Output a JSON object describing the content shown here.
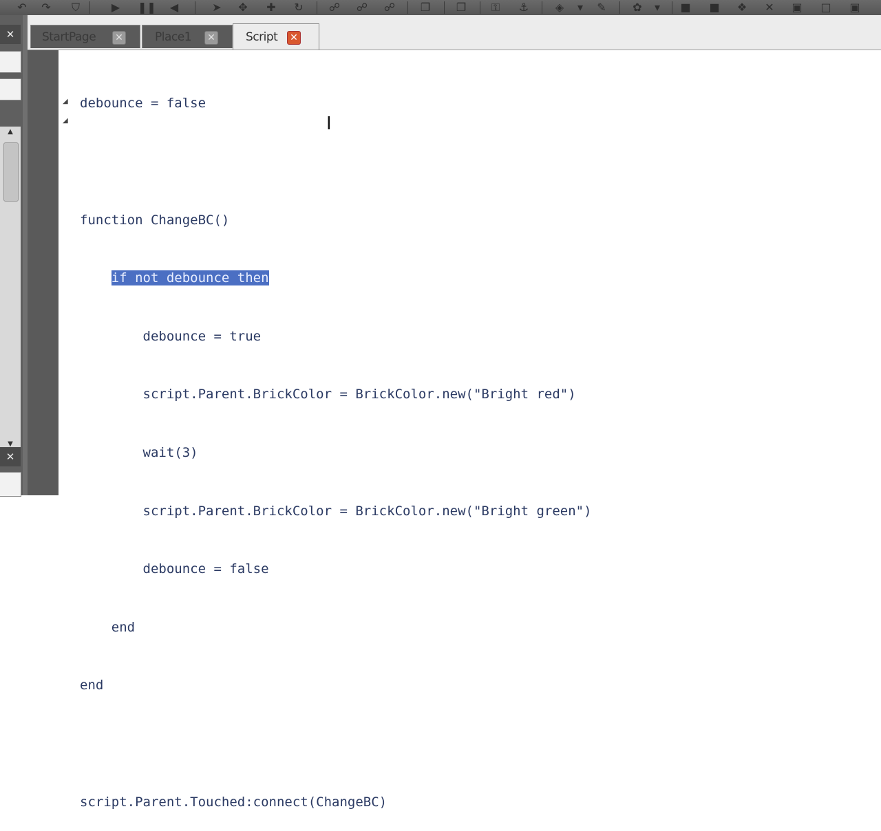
{
  "toolbar": {
    "icons": [
      "undo-icon",
      "redo-icon",
      "lock-icon",
      "play-icon",
      "pause-icon",
      "stop-icon",
      "select-icon",
      "move-icon",
      "scale-icon",
      "rotate-icon",
      "group-icon",
      "ungroup-icon",
      "color-icon",
      "anchor-icon",
      "lock-part-icon",
      "anchor2-icon",
      "paint-icon",
      "dropdown-icon",
      "brush-icon",
      "surface-icon",
      "dropdown2-icon",
      "part-icon",
      "part2-icon",
      "part3-icon",
      "part4-icon",
      "part5-icon",
      "part6-icon",
      "part7-icon"
    ]
  },
  "tabs": [
    {
      "label": "StartPage",
      "active": false
    },
    {
      "label": "Place1",
      "active": false
    },
    {
      "label": "Script",
      "active": true
    }
  ],
  "editor": {
    "lines": [
      {
        "indent": "",
        "text": "debounce = false"
      },
      {
        "indent": "",
        "text": ""
      },
      {
        "indent": "",
        "text": "function ChangeBC()"
      },
      {
        "indent": "    ",
        "text": "if not debounce then"
      },
      {
        "indent": "        ",
        "text": "debounce = true"
      },
      {
        "indent": "        ",
        "text": "script.Parent.BrickColor = BrickColor.new(\"Bright red\")"
      },
      {
        "indent": "        ",
        "text": "wait(3)"
      },
      {
        "indent": "        ",
        "text": "script.Parent.BrickColor = BrickColor.new(\"Bright green\")"
      },
      {
        "indent": "        ",
        "text": "debounce = false"
      },
      {
        "indent": "    ",
        "text": "end"
      },
      {
        "indent": "",
        "text": "end"
      },
      {
        "indent": "",
        "text": ""
      },
      {
        "indent": "",
        "text": "script.Parent.Touched:connect(ChangeBC)"
      }
    ],
    "selection_color": "#4b6fc3"
  }
}
